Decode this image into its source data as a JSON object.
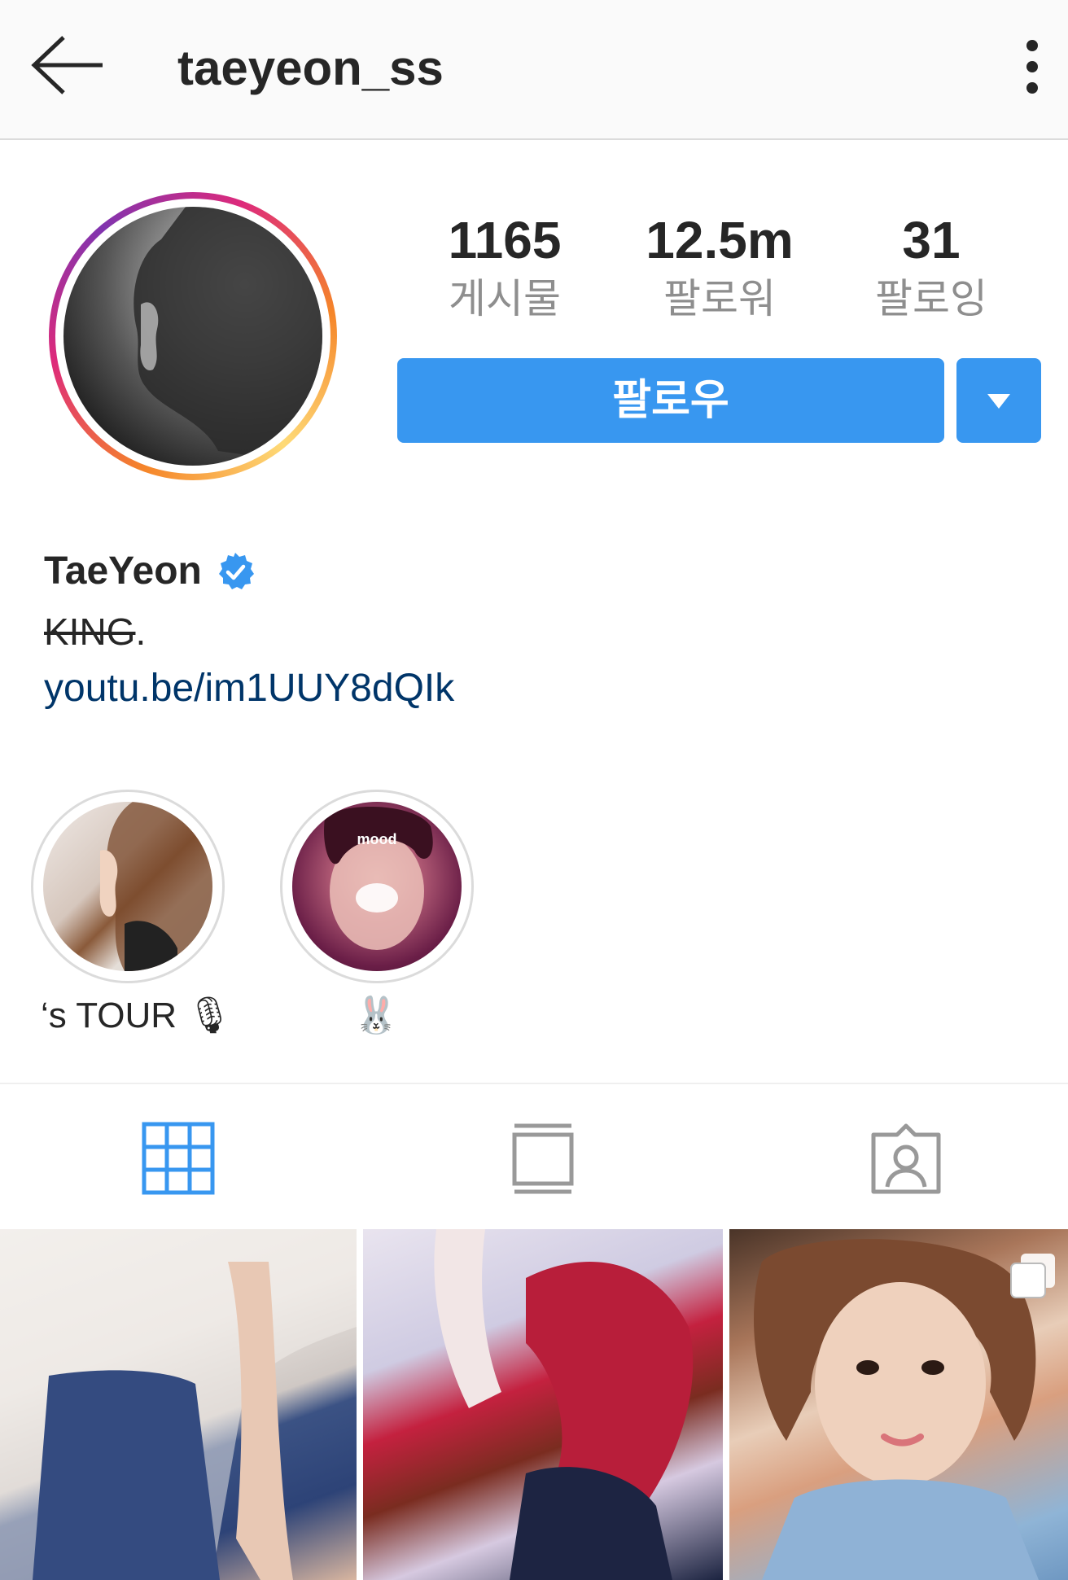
{
  "header": {
    "username": "taeyeon_ss",
    "back_icon": "arrow-left-icon",
    "more_icon": "more-vertical-icon"
  },
  "profile": {
    "stats": [
      {
        "value": "1165",
        "label": "게시물"
      },
      {
        "value": "12.5m",
        "label": "팔로워"
      },
      {
        "value": "31",
        "label": "팔로잉"
      }
    ],
    "follow_label": "팔로우",
    "display_name": "TaeYeon",
    "verified": true,
    "bio_strike": "KING",
    "bio_suffix": ".",
    "link": "youtu.be/im1UUY8dQIk"
  },
  "highlights": [
    {
      "label": "‘s TOUR 🎙"
    },
    {
      "label": "🐰",
      "overlay_text": "mood"
    }
  ],
  "tabs": [
    {
      "icon": "grid-icon",
      "active": true
    },
    {
      "icon": "feed-icon",
      "active": false
    },
    {
      "icon": "tagged-icon",
      "active": false
    }
  ],
  "colors": {
    "accent": "#3897f0",
    "active_tab": "#3897f0",
    "inactive_tab": "#999999",
    "link": "#003569"
  }
}
